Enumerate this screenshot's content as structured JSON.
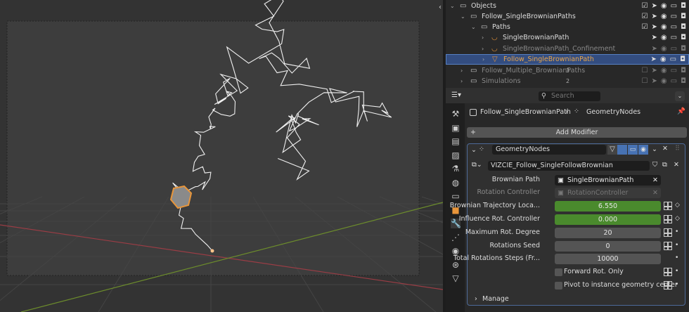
{
  "outliner": {
    "rows": [
      {
        "label": "Objects",
        "level": 0
      },
      {
        "label": "Follow_SingleBrownianPaths",
        "level": 1
      },
      {
        "label": "Paths",
        "level": 2
      },
      {
        "label": "SingleBrownianPath",
        "level": 3
      },
      {
        "label": "SingleBrownianPath_Confinement",
        "level": 3,
        "disabled": true
      },
      {
        "label": "Follow_SingleBrownianPath",
        "level": 3,
        "selected": true
      },
      {
        "label": "Follow_Multiple_BrownianPaths",
        "level": 1,
        "disabled": true,
        "count": "3"
      },
      {
        "label": "Simulations",
        "level": 1,
        "disabled": true,
        "count": "2"
      }
    ]
  },
  "properties": {
    "search_placeholder": "Search",
    "breadcrumb_object": "Follow_SingleBrownianPath",
    "breadcrumb_modifier": "GeometryNodes",
    "add_modifier": "Add Modifier",
    "modifier": {
      "name": "GeometryNodes",
      "node_group": "VIZCIE_Follow_SingleFollowBrownian",
      "inputs": [
        {
          "label": "Brownian Path",
          "value": "SingleBrownianPath"
        },
        {
          "label": "Rotation Controller",
          "value": "RotationController"
        },
        {
          "label": "Brownian Trajectory Loca...",
          "value": "6.550"
        },
        {
          "label": "Influence Rot. Controller",
          "value": "0.000"
        },
        {
          "label": "Maximum Rot. Degree",
          "value": "20"
        },
        {
          "label": "Rotations Seed",
          "value": "0"
        },
        {
          "label": "Total Rotations Steps (Fr...",
          "value": "10000"
        },
        {
          "label": "Forward Rot. Only",
          "checked": false
        },
        {
          "label": "Pivot to instance geometry center",
          "checked": false
        }
      ],
      "manage": "Manage"
    }
  },
  "colors": {
    "accent": "#4772b3",
    "green_field": "#4a8a2d",
    "object_orange": "#e8953a"
  }
}
